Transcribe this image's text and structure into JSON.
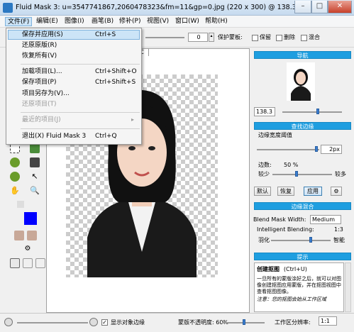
{
  "window": {
    "title": "Fluid Mask 3: u=3547741867,2060478323&fm=11&gp=0.jpg (220 x 300) @ 138.3%",
    "minimize": "–",
    "maximize": "□",
    "close": "✕"
  },
  "menubar": {
    "items": [
      "文件(F)",
      "编辑(E)",
      "图像(I)",
      "画笔(B)",
      "修补(P)",
      "视图(V)",
      "窗口(W)",
      "帮助(H)"
    ]
  },
  "file_menu": {
    "items": [
      {
        "label": "保存并应用(S)",
        "shortcut": "Ctrl+S",
        "enabled": true
      },
      {
        "label": "还原原版(R)",
        "shortcut": "",
        "enabled": true
      },
      {
        "label": "恢复所有(V)",
        "shortcut": "",
        "enabled": true
      },
      {
        "label": "加载项目(L)...",
        "shortcut": "Ctrl+Shift+O",
        "enabled": true
      },
      {
        "label": "保存项目(P)",
        "shortcut": "Ctrl+Shift+S",
        "enabled": true
      },
      {
        "label": "项目另存为(V)...",
        "shortcut": "",
        "enabled": true
      },
      {
        "label": "还原项目(T)",
        "shortcut": "",
        "enabled": false
      },
      {
        "label": "最近的项目(J)",
        "shortcut": "▸",
        "enabled": false
      },
      {
        "label": "退出(X) Fluid Mask 3",
        "shortcut": "Ctrl+Q",
        "enabled": true
      }
    ]
  },
  "toolbar": {
    "value": "0",
    "protect_label": "保护蒙板:",
    "protect_opt": "保留",
    "delete_opt": "删除",
    "mix_opt": "混合"
  },
  "doc_tab": "C",
  "panels": {
    "navigator": {
      "title": "导航",
      "zoom": "138.3"
    },
    "find_edges": {
      "title": "查找边缘",
      "edge_width_label": "边缘宽度阈值",
      "edge_width_value": "2px",
      "detail_label": "边数:",
      "detail_value": "50 %",
      "less": "较少",
      "more": "较多",
      "btn_default": "默认",
      "btn_restore": "恢复",
      "btn_apply": "应用"
    },
    "edge_blend": {
      "title": "边缘混合",
      "blend_mask_label": "Blend Mask Width:",
      "blend_mask_value": "Medium",
      "intelligent_label": "Intelligent Blending:",
      "intelligent_value": "1:3",
      "feather_label": "羽化",
      "smart_label": "智能"
    },
    "tips": {
      "title": "提示",
      "heading": "创建抠图",
      "shortcut": "(Ctrl+U)",
      "body1": "一旦所有的蒙版涂好之后，就可以对图像创建抠图应用蒙版，并在抠图视图中查看抠图图像。",
      "note_label": "注意：",
      "body2": "您的抠图会始从工作区域"
    }
  },
  "statusbar": {
    "show_edges": "显示对象边缘",
    "mask_opacity": "蒙版不透明度: 60%",
    "work_area": "工作区分辨率:",
    "ratio": "1:1"
  }
}
